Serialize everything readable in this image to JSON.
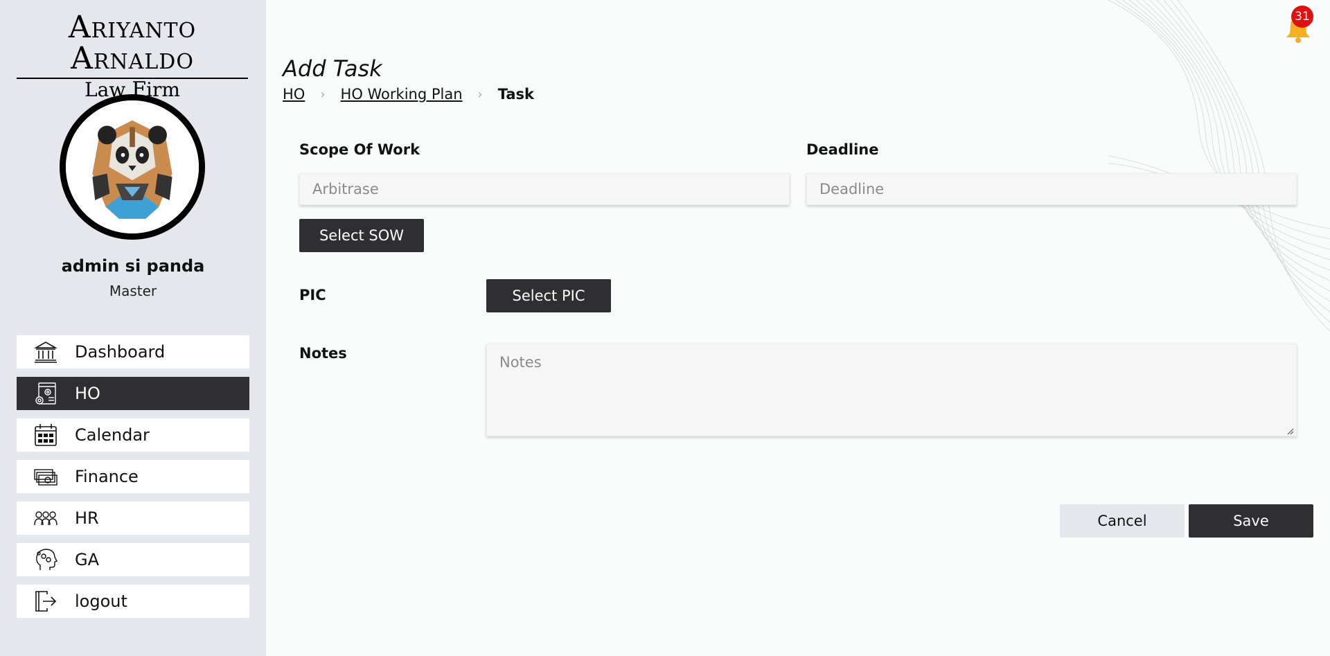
{
  "brand": {
    "line1_first": "A",
    "line1_first_rest": "RIYANTO ",
    "line1_second": "A",
    "line1_second_rest": "RNALDO",
    "line2_first": "Law ",
    "line2_f": "F",
    "line2_rest": "irm"
  },
  "user": {
    "name": "admin si panda",
    "role": "Master"
  },
  "nav": {
    "items": [
      {
        "label": "Dashboard",
        "icon": "bank-icon"
      },
      {
        "label": "HO",
        "icon": "settings-document-icon"
      },
      {
        "label": "Calendar",
        "icon": "calendar-icon"
      },
      {
        "label": "Finance",
        "icon": "money-icon"
      },
      {
        "label": "HR",
        "icon": "people-icon"
      },
      {
        "label": "GA",
        "icon": "head-gears-icon"
      },
      {
        "label": "logout",
        "icon": "logout-icon"
      }
    ],
    "active": "HO"
  },
  "notifications": {
    "count": "31"
  },
  "page": {
    "title": "Add Task",
    "breadcrumb": [
      "HO",
      "HO Working Plan",
      "Task"
    ]
  },
  "form": {
    "scope_label": "Scope Of Work",
    "scope_value": "Arbitrase",
    "select_sow": "Select SOW",
    "deadline_label": "Deadline",
    "deadline_placeholder": "Deadline",
    "pic_label": "PIC",
    "select_pic": "Select PIC",
    "notes_label": "Notes",
    "notes_placeholder": "Notes"
  },
  "actions": {
    "cancel": "Cancel",
    "save": "Save"
  },
  "colors": {
    "sidebar_bg": "#e5e7ec",
    "dark": "#2f2f31",
    "badge": "#e01010",
    "bell": "#f5b021"
  }
}
